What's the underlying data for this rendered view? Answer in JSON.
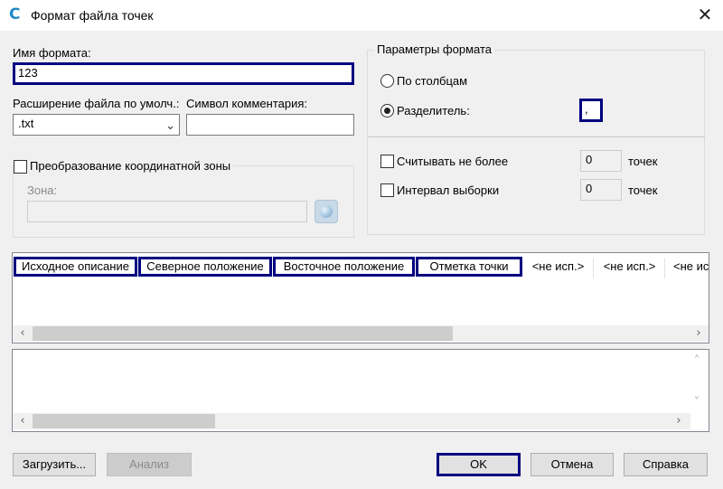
{
  "window": {
    "title": "Формат файла точек",
    "app_icon_glyph": "C",
    "close_glyph": "✕"
  },
  "format_name": {
    "label": "Имя формата:",
    "value": "123"
  },
  "file_extension": {
    "label": "Расширение файла по умолч.:",
    "value": ".txt"
  },
  "comment_symbol": {
    "label": "Символ комментария:",
    "value": ""
  },
  "zone_conversion": {
    "label": "Преобразование координатной зоны",
    "zone_label": "Зона:",
    "zone_value": ""
  },
  "format_params": {
    "title": "Параметры формата",
    "by_columns_label": "По столбцам",
    "delimiter_label": "Разделитель:",
    "delimiter_value": ",",
    "read_max_label": "Считывать не более",
    "read_max_value": "0",
    "read_max_unit": "точек",
    "sample_interval_label": "Интервал выборки",
    "sample_interval_value": "0",
    "sample_interval_unit": "точек"
  },
  "columns": [
    "Исходное описание",
    "Северное положение",
    "Восточное положение",
    "Отметка точки",
    "<не исп.>",
    "<не исп.>",
    "<не ис"
  ],
  "buttons": {
    "load": "Загрузить...",
    "analyze": "Анализ",
    "ok": "OK",
    "cancel": "Отмена",
    "help": "Справка"
  },
  "icons": {
    "dropdown": "chevron-down-icon",
    "globe": "globe-icon",
    "scroll_left": "‹",
    "scroll_right": "›",
    "scroll_up": "˄",
    "scroll_down": "˅"
  },
  "colors": {
    "focus_border": "#000080",
    "window_bg": "#f0f0f0",
    "accent_icon": "#1e88c8"
  }
}
